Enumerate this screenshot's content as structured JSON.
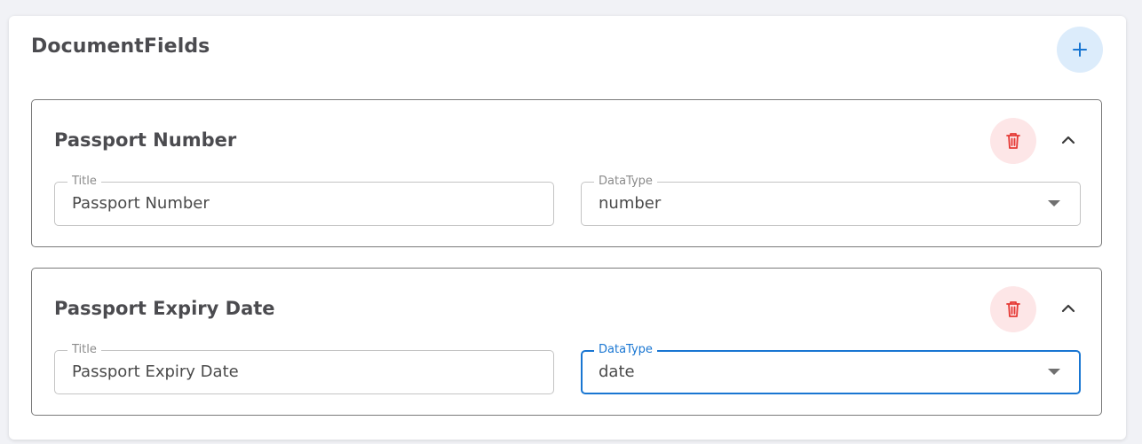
{
  "panel": {
    "title": "DocumentFields",
    "add_button_icon": "plus-icon",
    "accent_color": "#1976d2"
  },
  "fields": [
    {
      "card_title": "Passport Number",
      "title_label": "Title",
      "title_value": "Passport Number",
      "datatype_label": "DataType",
      "datatype_value": "number",
      "delete_icon": "trash-icon",
      "collapse_icon": "chevron-up-icon"
    },
    {
      "card_title": "Passport Expiry Date",
      "title_label": "Title",
      "title_value": "Passport Expiry Date",
      "datatype_label": "DataType",
      "datatype_value": "date",
      "delete_icon": "trash-icon",
      "collapse_icon": "chevron-up-icon"
    }
  ]
}
